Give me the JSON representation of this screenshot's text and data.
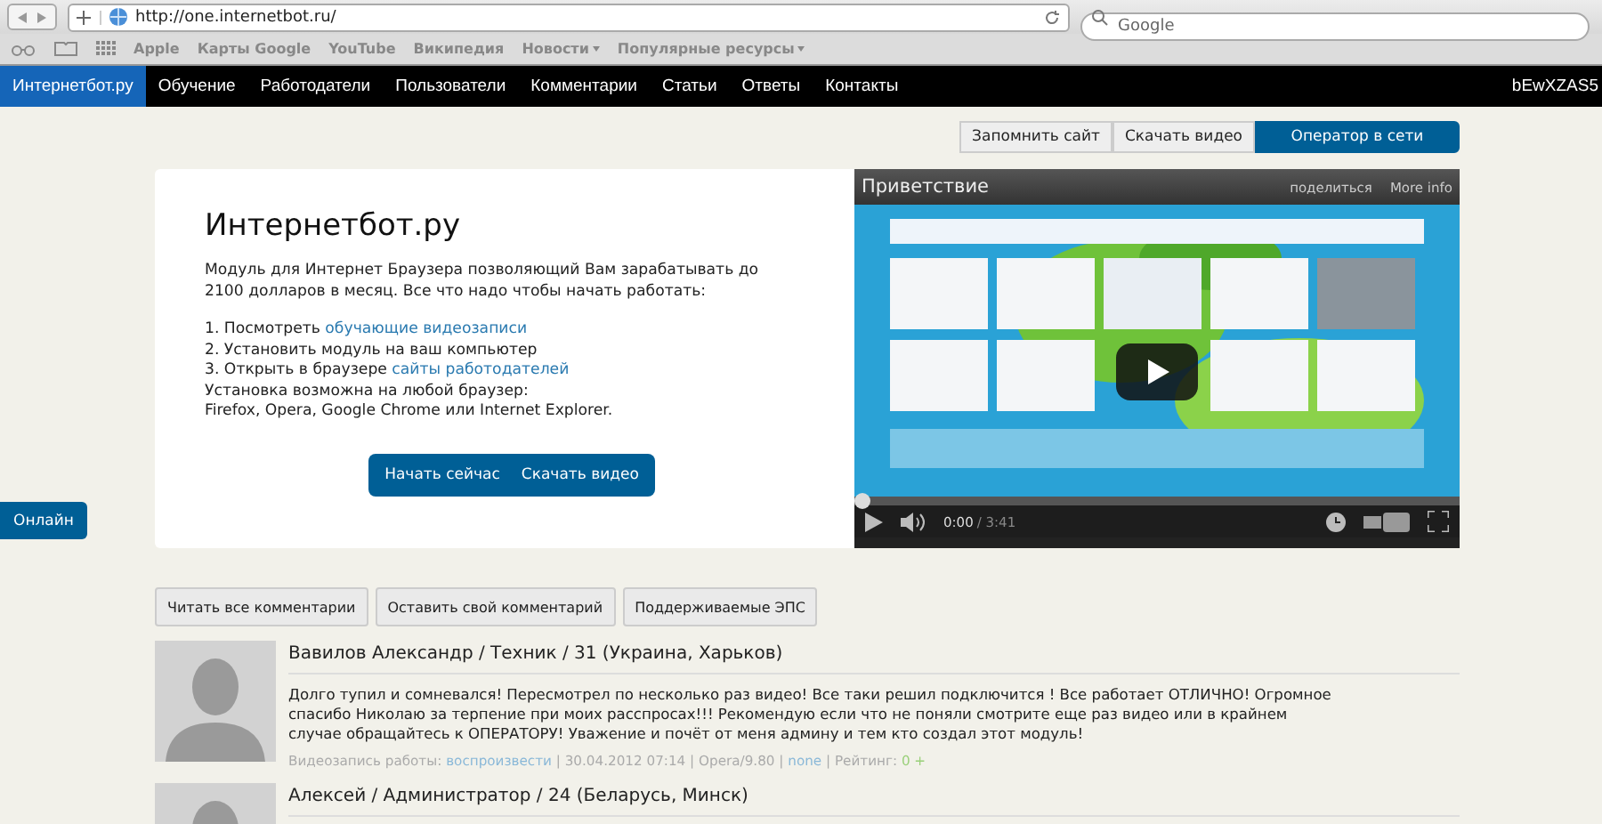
{
  "browser": {
    "url": "http://one.internetbot.ru/",
    "search_placeholder": "Google",
    "bookmarks": [
      {
        "label": "Apple",
        "menu": false
      },
      {
        "label": "Карты Google",
        "menu": false
      },
      {
        "label": "YouTube",
        "menu": false
      },
      {
        "label": "Википедия",
        "menu": false
      },
      {
        "label": "Новости",
        "menu": true
      },
      {
        "label": "Популярные ресурсы",
        "menu": true
      }
    ]
  },
  "nav": {
    "items": [
      {
        "label": "Интернетбот.ру",
        "selected": true
      },
      {
        "label": "Обучение",
        "selected": false
      },
      {
        "label": "Работодатели",
        "selected": false
      },
      {
        "label": "Пользователи",
        "selected": false
      },
      {
        "label": "Комментарии",
        "selected": false
      },
      {
        "label": "Статьи",
        "selected": false
      },
      {
        "label": "Ответы",
        "selected": false
      },
      {
        "label": "Контакты",
        "selected": false
      }
    ],
    "user": "bEwXZAS5"
  },
  "top_actions": [
    {
      "label": "Запомнить сайт",
      "kind": "plain"
    },
    {
      "label": "Скачать видео",
      "kind": "plain"
    },
    {
      "label": "Оператор в сети",
      "kind": "primary"
    }
  ],
  "hero": {
    "title": "Интернетбот.ру",
    "intro": "Модуль для Интернет Браузера позволяющий Вам зарабатывать до 2100 долларов в месяц. Все что надо чтобы начать работать:",
    "lines": [
      {
        "text": "1. Посмотреть ",
        "link": "обучающие видеозаписи"
      },
      {
        "text": "2. Установить модуль на ваш компьютер"
      },
      {
        "text": "3. Открыть в браузере ",
        "link": "сайты работодателей"
      },
      {
        "text": "Установка возможна на любой браузер:"
      },
      {
        "text": "Firefox, Opera, Google Chrome или Internet Explorer."
      }
    ],
    "buttons": [
      "Начать сейчас",
      "Скачать видео"
    ]
  },
  "video": {
    "title": "Приветствие",
    "share": "поделиться",
    "more_info": "More info",
    "time": "0:00",
    "duration": "/ 3:41",
    "level": 0
  },
  "online_tab": "Онлайн",
  "comment_tabs": [
    "Читать все комментарии",
    "Оставить свой комментарий",
    "Поддерживаемые ЭПС"
  ],
  "comments": [
    {
      "heading": "Вавилов Александр / Техник / 31 (Украина, Харьков)",
      "text": "Долго тупил и сомневался! Пересмотрел по несколько раз видео! Все таки решил подключится ! Все работает ОТЛИЧНО! Огромное спасибо Николаю за терпение при моих расспросах!!! Рекомендую если что не поняли смотрите еще раз видео или в крайнем случае обращайтесь к ОПЕРАТОРУ! Уважение и почёт от меня админу и тем кто создал этот модуль!",
      "meta": [
        {
          "text": "Видеозапись работы: ",
          "kind": "plain"
        },
        {
          "text": "воспроизвести",
          "kind": "link"
        },
        {
          "text": " | 30.04.2012 07:14 | Opera/9.80 | ",
          "kind": "plain"
        },
        {
          "text": "none",
          "kind": "link"
        },
        {
          "text": " | Рейтинг: ",
          "kind": "plain"
        },
        {
          "text": "0 +",
          "kind": "rating"
        }
      ]
    },
    {
      "heading": "Алексей / Администратор / 24 (Беларусь, Минск)"
    }
  ]
}
